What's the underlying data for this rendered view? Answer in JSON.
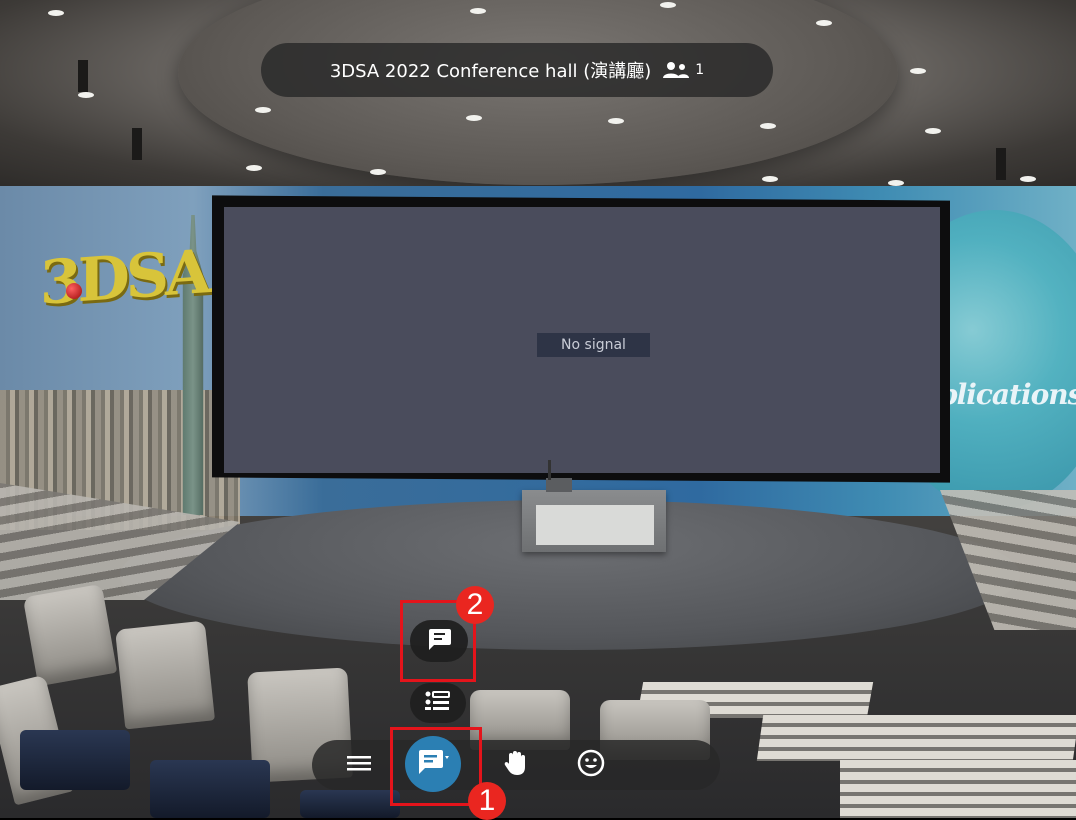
{
  "room": {
    "title": "3DSA 2022 Conference hall (演講廳)",
    "people_icon": "people-icon",
    "participant_count": "1"
  },
  "scene": {
    "screen_text": "No signal",
    "logo_text": "3DSA",
    "backdrop_text": "plications"
  },
  "toolbar": {
    "menu_icon": "menu-icon",
    "chat_icon": "chat-icon",
    "dropdown_icon": "dropdown-arrow-icon",
    "hand_icon": "raise-hand-icon",
    "emoji_icon": "emoji-icon"
  },
  "chat_menu": {
    "options": [
      {
        "icon": "chat-icon"
      },
      {
        "icon": "list-icon"
      }
    ]
  },
  "annotations": {
    "badge_1": "1",
    "badge_2": "2",
    "highlight_color": "#e4141b"
  },
  "colors": {
    "accent": "#2b7fb3",
    "pill_bg": "#282828"
  }
}
